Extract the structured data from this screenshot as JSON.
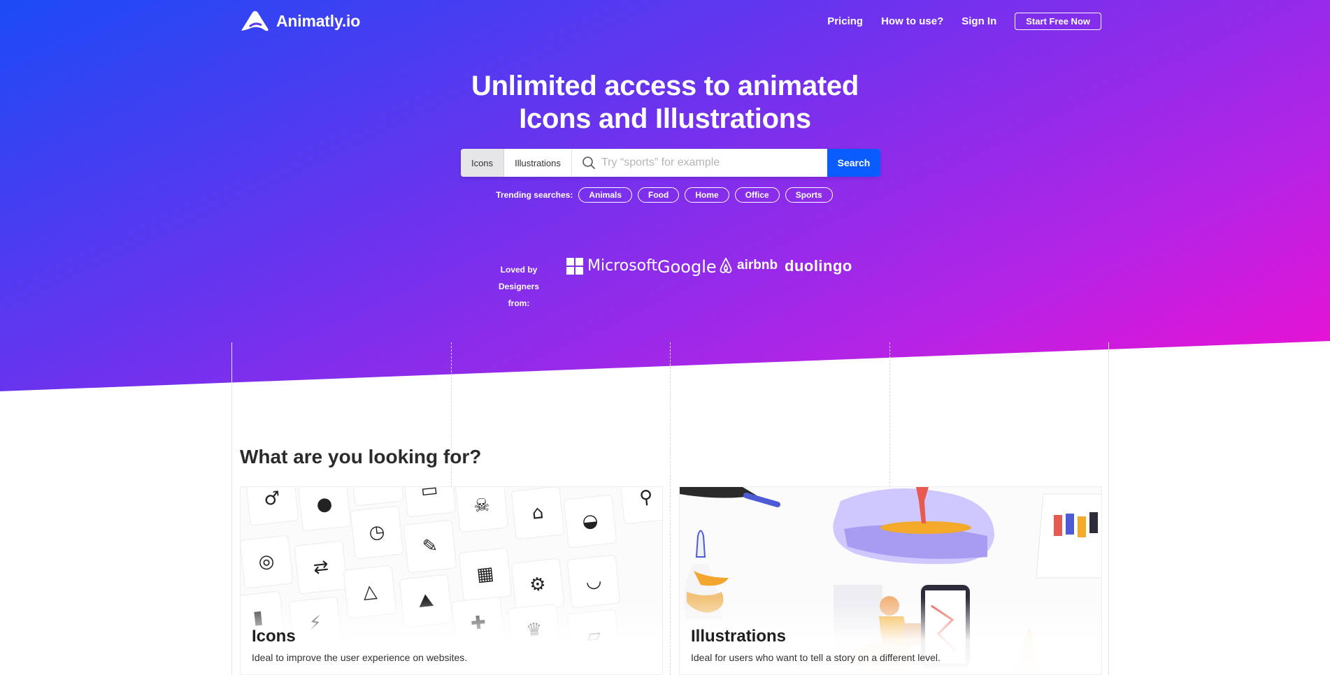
{
  "brand": {
    "name": "Animatly.io",
    "icon": "animatly-logo-icon"
  },
  "nav": {
    "links": [
      "Pricing",
      "How to use?",
      "Sign In"
    ],
    "cta": "Start Free Now"
  },
  "hero": {
    "headline_line1": "Unlimited access to animated",
    "headline_line2": "Icons and Illustrations"
  },
  "search": {
    "segments": [
      "Icons",
      "Illustrations"
    ],
    "selected_segment": "Icons",
    "placeholder": "Try “sports” for example",
    "value": "",
    "button": "Search",
    "icon": "search-icon"
  },
  "trending": {
    "label": "Trending searches:",
    "chips": [
      "Animals",
      "Food",
      "Home",
      "Office",
      "Sports"
    ]
  },
  "loved_by": {
    "label_line1": "Loved by",
    "label_line2": "Designers from:",
    "brands": [
      "Microsoft",
      "Google",
      "airbnb",
      "duolingo"
    ]
  },
  "section": {
    "title": "What are you looking for?"
  },
  "cards": [
    {
      "title": "Icons",
      "description": "Ideal to improve the user experience on websites."
    },
    {
      "title": "Illustrations",
      "description": "Ideal for users who want to tell a story on a different level."
    }
  ],
  "colors": {
    "gradient_start": "#1b4bf5",
    "gradient_mid": "#6a33ee",
    "gradient_end": "#f00fd1",
    "search_button": "#0a5cff"
  }
}
